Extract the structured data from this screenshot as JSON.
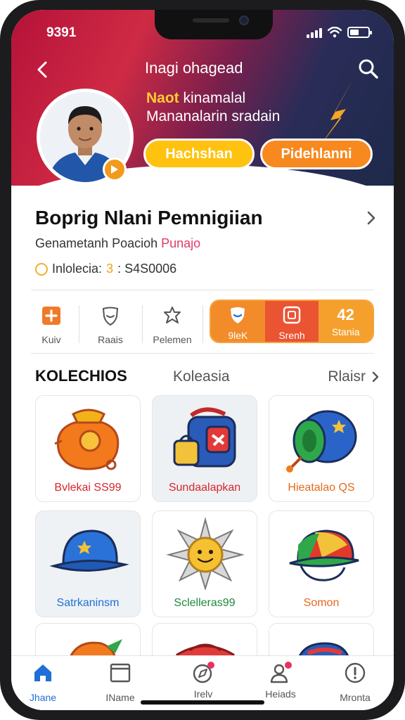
{
  "status_bar": {
    "time": "9391"
  },
  "header": {
    "title": "Inagi ohagead",
    "line1_highlight": "Naot",
    "line1_rest": " kinamalal",
    "line2": "Mananalarin sradain",
    "pill_left": "Hachshan",
    "pill_right": "Pidehlanni"
  },
  "profile": {
    "name": "Boprig Nlani Pemnigiian",
    "subtitle_main": "Genametanh Poacioh ",
    "subtitle_accent": "Punajo",
    "meta_label": "Inlolecia: ",
    "meta_number": "3",
    "meta_value": " : S4S0006"
  },
  "actions": [
    {
      "label": "Kuiv",
      "icon": "plus-box-icon"
    },
    {
      "label": "Raais",
      "icon": "shield-outline-icon"
    },
    {
      "label": "Pelemen",
      "icon": "flower-outline-icon"
    }
  ],
  "segments": [
    {
      "label": "9leK",
      "icon": "shield-badge-icon"
    },
    {
      "label": "Srenh",
      "icon": "frame-icon"
    },
    {
      "label": "Stania",
      "icon": "numbers-icon",
      "glyph": "42"
    }
  ],
  "collections": {
    "heading": "KOLECHIOS",
    "tab": "Koleasia",
    "more": "Rlaisr",
    "items": [
      {
        "title": "Bvlekai SS99",
        "color": "#d7262c",
        "icon": "coin-bag-icon"
      },
      {
        "title": "Sundaalapkan",
        "color": "#d7262c",
        "icon": "backpack-icon"
      },
      {
        "title": "Hieatalao QS",
        "color": "#e56a1c",
        "icon": "drum-icon"
      },
      {
        "title": "Satrkaninsm",
        "color": "#1f6fd6",
        "icon": "cap-icon"
      },
      {
        "title": "Sclelleras99",
        "color": "#1d8a3a",
        "icon": "sun-star-icon"
      },
      {
        "title": "Somon",
        "color": "#e56a1c",
        "icon": "helmet-icon"
      }
    ]
  },
  "bottom_nav": [
    {
      "label": "Jhane",
      "icon": "home-icon",
      "active": true
    },
    {
      "label": "IName",
      "icon": "window-icon",
      "active": false
    },
    {
      "label": "Irelv",
      "icon": "compass-icon",
      "active": false
    },
    {
      "label": "Heiads",
      "icon": "people-icon",
      "active": false
    },
    {
      "label": "Mronta",
      "icon": "info-circle-icon",
      "active": false
    }
  ],
  "colors": {
    "accent_orange": "#f7891f",
    "accent_yellow": "#ffc20e",
    "accent_red": "#ea5433",
    "active_blue": "#1f6fd6"
  }
}
